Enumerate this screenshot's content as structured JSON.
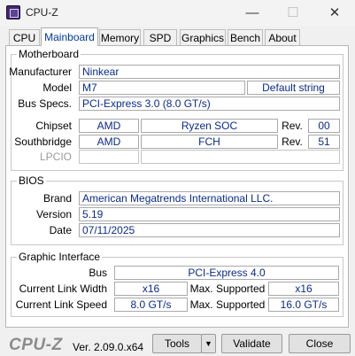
{
  "window": {
    "title": "CPU-Z"
  },
  "tabs": [
    "CPU",
    "Mainboard",
    "Memory",
    "SPD",
    "Graphics",
    "Bench",
    "About"
  ],
  "motherboard": {
    "title": "Motherboard",
    "manufacturer_label": "Manufacturer",
    "manufacturer": "Ninkear",
    "model_label": "Model",
    "model": "M7",
    "model_revision": "Default string",
    "bus_specs_label": "Bus Specs.",
    "bus_specs": "PCI-Express 3.0 (8.0 GT/s)",
    "chipset_label": "Chipset",
    "chipset_vendor": "AMD",
    "chipset_model": "Ryzen SOC",
    "chipset_rev_label": "Rev.",
    "chipset_rev": "00",
    "southbridge_label": "Southbridge",
    "southbridge_vendor": "AMD",
    "southbridge_model": "FCH",
    "southbridge_rev_label": "Rev.",
    "southbridge_rev": "51",
    "lpcio_label": "LPCIO"
  },
  "bios": {
    "title": "BIOS",
    "brand_label": "Brand",
    "brand": "American Megatrends International LLC.",
    "version_label": "Version",
    "version": "5.19",
    "date_label": "Date",
    "date": "07/11/2025"
  },
  "graphic_interface": {
    "title": "Graphic Interface",
    "bus_label": "Bus",
    "bus": "PCI-Express 4.0",
    "link_width_label": "Current Link Width",
    "link_width": "x16",
    "max_width_label": "Max. Supported",
    "max_width": "x16",
    "link_speed_label": "Current Link Speed",
    "link_speed": "8.0 GT/s",
    "max_speed_label": "Max. Supported",
    "max_speed": "16.0 GT/s"
  },
  "footer": {
    "logo": "CPU-Z",
    "version": "Ver. 2.09.0.x64",
    "tools_label": "Tools",
    "tools_arrow": "▼",
    "validate_label": "Validate",
    "close_label": "Close"
  }
}
